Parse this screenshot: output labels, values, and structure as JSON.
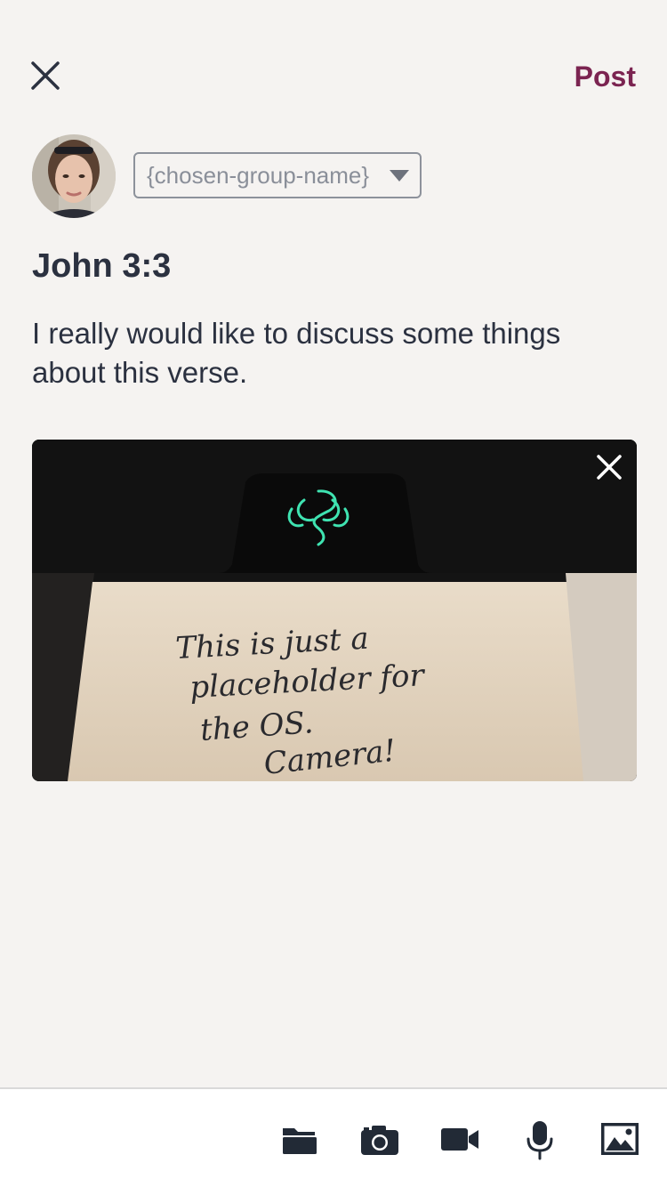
{
  "header": {
    "close_icon": "close-icon",
    "post_label": "Post",
    "post_color": "#7b2451"
  },
  "composer": {
    "group_select_value": "{chosen-group-name}",
    "title": "John 3:3",
    "body": "I really would like to discuss some things about this verse."
  },
  "attachment": {
    "handwriting": [
      "This is just a",
      "placeholder for",
      "the OS.",
      "Camera!"
    ],
    "remove_icon": "close-icon"
  },
  "toolbar": {
    "icons": [
      "folder-icon",
      "camera-icon",
      "video-icon",
      "microphone-icon",
      "image-icon"
    ]
  }
}
